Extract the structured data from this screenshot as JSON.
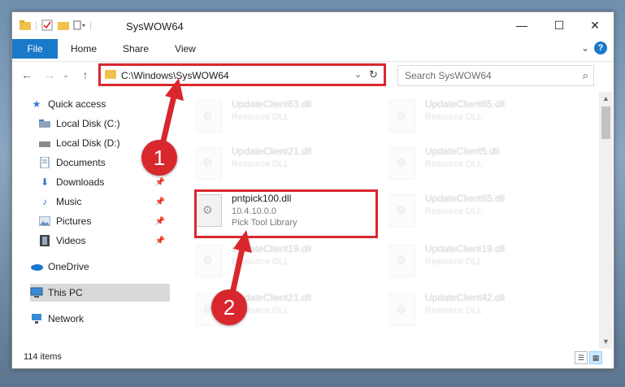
{
  "window": {
    "title": "SysWOW64"
  },
  "ribbon": {
    "tabs": [
      "File",
      "Home",
      "Share",
      "View"
    ]
  },
  "address": {
    "path": "C:\\Windows\\SysWOW64"
  },
  "search": {
    "placeholder": "Search SysWOW64"
  },
  "navpane": {
    "items": [
      {
        "label": "Quick access",
        "icon": "star-icon"
      },
      {
        "label": "Local Disk (C:)",
        "icon": "drive-icon"
      },
      {
        "label": "Local Disk (D:)",
        "icon": "drive-icon"
      },
      {
        "label": "Documents",
        "icon": "documents-icon"
      },
      {
        "label": "Downloads",
        "icon": "download-icon"
      },
      {
        "label": "Music",
        "icon": "music-icon"
      },
      {
        "label": "Pictures",
        "icon": "pictures-icon"
      },
      {
        "label": "Videos",
        "icon": "videos-icon"
      },
      {
        "label": "OneDrive",
        "icon": "cloud-icon"
      },
      {
        "label": "This PC",
        "icon": "computer-icon"
      },
      {
        "label": "Network",
        "icon": "network-icon"
      }
    ]
  },
  "files": [
    {
      "name": "UpdateClient63.dll",
      "desc": "Resource DLL"
    },
    {
      "name": "UpdateClient65.dll",
      "desc": "Resource DLL"
    },
    {
      "name": "UpdateClient21.dll",
      "desc": "Resource DLL"
    },
    {
      "name": "UpdateClient5.dll",
      "desc": "Resource DLL"
    },
    {
      "name": "pntpick100.dll",
      "version": "10.4.10.0.0",
      "desc": "Pick Tool Library"
    },
    {
      "name": "UpdateClient65.dll",
      "desc": "Resource DLL"
    },
    {
      "name": "UpdateClient19.dll",
      "desc": "Resource DLL"
    },
    {
      "name": "UpdateClient19.dll",
      "desc": "Resource DLL"
    },
    {
      "name": "UpdateClient21.dll",
      "desc": "Resource DLL"
    },
    {
      "name": "UpdateClient42.dll",
      "desc": "Resource DLL"
    }
  ],
  "status": {
    "count": "114 items"
  },
  "annotations": {
    "step1": "1",
    "step2": "2",
    "color": "#d9272e"
  }
}
